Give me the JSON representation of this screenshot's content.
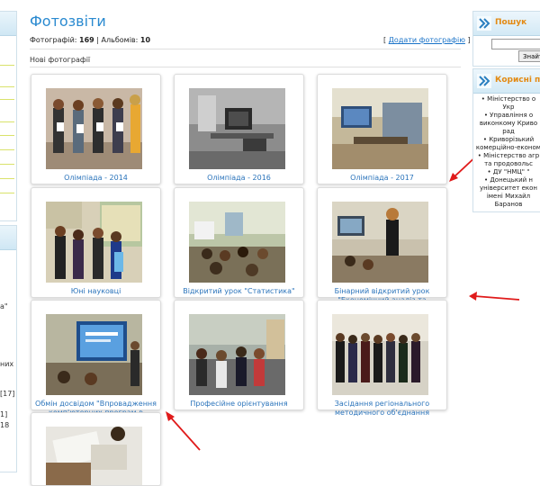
{
  "page": {
    "title": "Фотозвіти",
    "stats_photos_label": "Фотографій:",
    "stats_photos_count": "169",
    "stats_sep": "|",
    "stats_albums_label": "Альбомів:",
    "stats_albums_count": "10",
    "add_photo_open": "[",
    "add_photo_label": "Додати фотографію",
    "add_photo_close": "]",
    "new_photos_label": "Нові фотографії"
  },
  "albums": [
    {
      "caption": "Олімпіада - 2014"
    },
    {
      "caption": "Олімпіада - 2016"
    },
    {
      "caption": "Олімпіада - 2017"
    },
    {
      "caption": "Юні науковці"
    },
    {
      "caption": "Відкритий урок \"Статистика\""
    },
    {
      "caption": "Бінарний відкритий урок \"Економічний аналіз та Статистика\""
    },
    {
      "caption": "Обмін досвідом \"Впровадження комп'ютерних програм в викладацькій діяльності\""
    },
    {
      "caption": "Професійне орієнтування"
    },
    {
      "caption": "Засідання регіонального методичного об'єднання"
    }
  ],
  "right": {
    "search_title": "Пошук",
    "search_button": "Знайт",
    "links_title": "Корисні по",
    "links": [
      "• Міністерство о",
      "Укр",
      "• Управління о",
      "виконкому Криво",
      "рад",
      "• Криворізький",
      "комерційно-економ",
      "• Міністерство агр",
      "та продовольс",
      "• ДУ \"НМЦ\" \"",
      "• Донецький н",
      "університет екон",
      "імені Михайл",
      "Баранов"
    ]
  },
  "left_fragments": [
    "а\"",
    "них",
    "[17]",
    "1]",
    "18"
  ],
  "colors": {
    "title": "#2a8ad0",
    "link": "#1a73c8",
    "caption": "#2b74bb",
    "accent_orange": "#e38a13",
    "annotation_red": "#e01b1b"
  },
  "icons": [
    "double-chevron-icon",
    "red-arrow-annotation"
  ]
}
